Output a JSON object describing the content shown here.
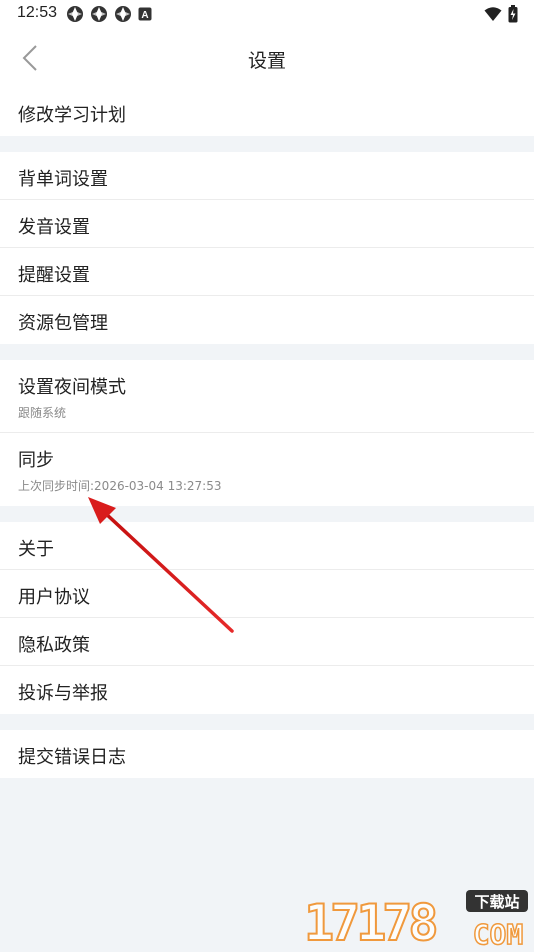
{
  "status_bar": {
    "time": "12:53",
    "badge": "A"
  },
  "nav": {
    "title": "设置"
  },
  "groups": [
    {
      "items": [
        {
          "label": "修改学习计划"
        }
      ]
    },
    {
      "items": [
        {
          "label": "背单词设置"
        },
        {
          "label": "发音设置"
        },
        {
          "label": "提醒设置"
        },
        {
          "label": "资源包管理"
        }
      ]
    },
    {
      "items": [
        {
          "label": "设置夜间模式",
          "sub": "跟随系统"
        },
        {
          "label": "同步",
          "sub": "上次同步时间:2026-03-04 13:27:53"
        }
      ]
    },
    {
      "items": [
        {
          "label": "关于"
        },
        {
          "label": "用户协议"
        },
        {
          "label": "隐私政策"
        },
        {
          "label": "投诉与举报"
        }
      ]
    },
    {
      "items": [
        {
          "label": "提交错误日志"
        }
      ]
    }
  ],
  "watermark": {
    "number": "17178",
    "tag": "下载站",
    "domain": "COM"
  },
  "colors": {
    "background": "#f1f4f7",
    "surface": "#ffffff",
    "divider": "#ececec",
    "annotation_arrow": "#d91c1c",
    "watermark_orange": "#f08a1d"
  }
}
